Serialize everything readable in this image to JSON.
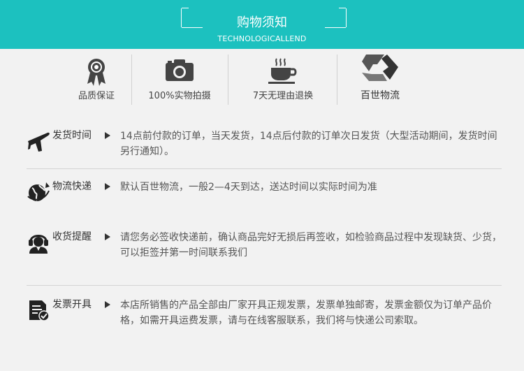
{
  "header": {
    "title": "购物须知",
    "subtitle": "TECHNOLOGICALLEND"
  },
  "features": [
    {
      "icon": "award-ribbon-icon",
      "label": "品质保证"
    },
    {
      "icon": "camera-icon",
      "label": "100%实物拍摄"
    },
    {
      "icon": "coffee-cup-icon",
      "label": "7天无理由退换"
    },
    {
      "icon": "best-logo-icon",
      "label": "百世物流"
    }
  ],
  "rows": [
    {
      "icon": "airplane-icon",
      "label": "发货时间",
      "text": "14点前付款的订单，当天发货，14点后付款的订单次日发货（大型活动期间，发货时间另行通知）。"
    },
    {
      "icon": "globe-icon",
      "label": "物流快递",
      "text": "默认百世物流，一般2—4天到达，送达时间以实际时间为准"
    },
    {
      "icon": "customer-service-icon",
      "label": "收货提醒",
      "text": "请您务必签收快递前，确认商品完好无损后再签收，如检验商品过程中发现缺货、少货，可以拒签并第一时间联系我们"
    },
    {
      "icon": "invoice-icon",
      "label": "发票开具",
      "text": "本店所销售的产品全部由厂家开具正规发票，发票单独邮寄，发票金额仅为订单产品价格，如需开具运费发票，请与在线客服联系，我们将与快递公司索取。"
    }
  ],
  "colors": {
    "accent": "#1cc1bf",
    "text": "#333333"
  }
}
